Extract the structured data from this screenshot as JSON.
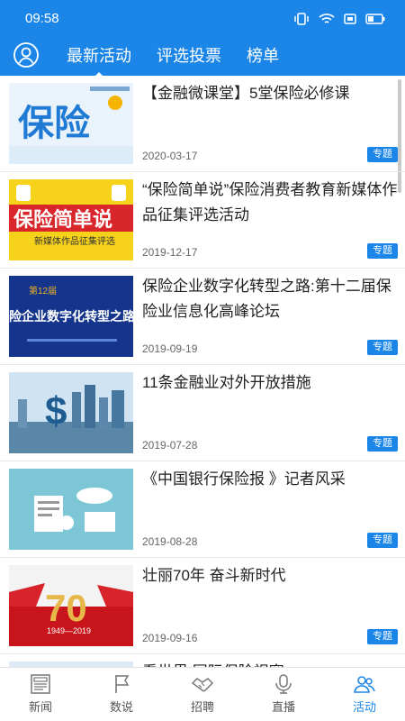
{
  "status": {
    "time": "09:58"
  },
  "tabs": [
    {
      "label": "最新活动",
      "active": true
    },
    {
      "label": "评选投票",
      "active": false
    },
    {
      "label": "榜单",
      "active": false
    }
  ],
  "articles": [
    {
      "title": "【金融微课堂】5堂保险必修课",
      "date": "2020-03-17",
      "tag": "专题",
      "thumb_text": "保险"
    },
    {
      "title": "“保险简单说”保险消费者教育新媒体作品征集评选活动",
      "date": "2019-12-17",
      "tag": "专题",
      "thumb_text": "保险简单说",
      "thumb_sub": "新媒体作品征集评选"
    },
    {
      "title": "保险企业数字化转型之路:第十二届保险业信息化高峰论坛",
      "date": "2019-09-19",
      "tag": "专题",
      "thumb_text": "险企业数字化转型之路",
      "thumb_sub": "第12届"
    },
    {
      "title": "11条金融业对外开放措施",
      "date": "2019-07-28",
      "tag": "专题"
    },
    {
      "title": "《中国银行保险报 》记者风采",
      "date": "2019-08-28",
      "tag": "专题"
    },
    {
      "title": "壮丽70年 奋斗新时代",
      "date": "2019-09-16",
      "tag": "专题",
      "thumb_text": "70",
      "thumb_sub": "1949—2019"
    },
    {
      "title": "看世界 国际保险视窗",
      "date": "",
      "tag": ""
    }
  ],
  "bottom_nav": [
    {
      "label": "新闻",
      "icon": "news-icon",
      "active": false
    },
    {
      "label": "数说",
      "icon": "flag-icon",
      "active": false
    },
    {
      "label": "招聘",
      "icon": "handshake-icon",
      "active": false
    },
    {
      "label": "直播",
      "icon": "microphone-icon",
      "active": false
    },
    {
      "label": "活动",
      "icon": "people-icon",
      "active": true
    }
  ],
  "colors": {
    "primary": "#1b86e8",
    "tag_bg": "#1b86e8",
    "text": "#222222"
  }
}
